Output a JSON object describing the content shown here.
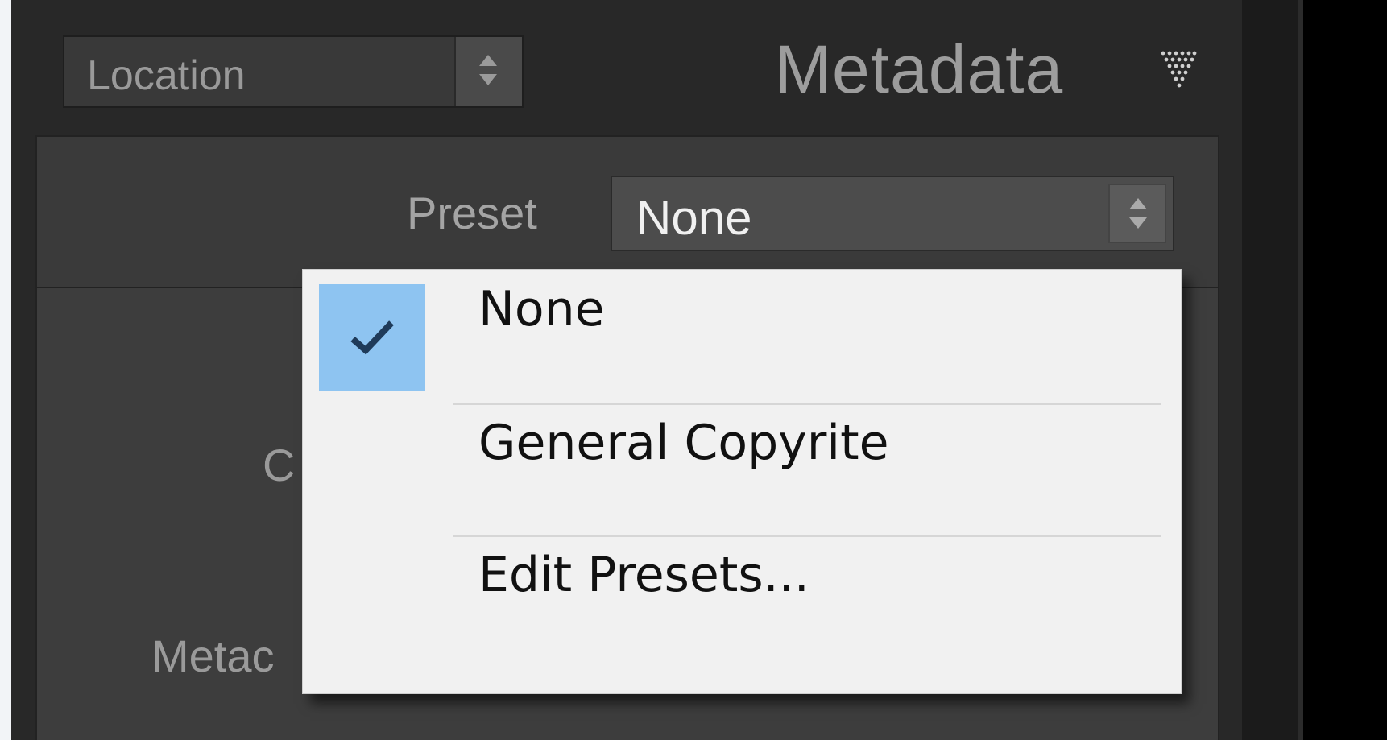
{
  "header": {
    "view_selector": {
      "value": "Location",
      "icon": "stepper-arrows-icon"
    },
    "panel_title": "Metadata",
    "collapse_icon": "collapse-triangle-icon"
  },
  "preset": {
    "label": "Preset",
    "selected_value": "None",
    "icon": "stepper-arrows-icon"
  },
  "background_labels": {
    "partial_c": "C",
    "partial_meta": "Metac"
  },
  "dropdown": {
    "items": [
      {
        "label": "None",
        "checked": true,
        "icon": "checkmark-icon"
      },
      {
        "label": "General Copyrite",
        "checked": false
      },
      {
        "label": "Edit Presets...",
        "checked": false
      }
    ],
    "check_color": "#8ec4f1"
  }
}
